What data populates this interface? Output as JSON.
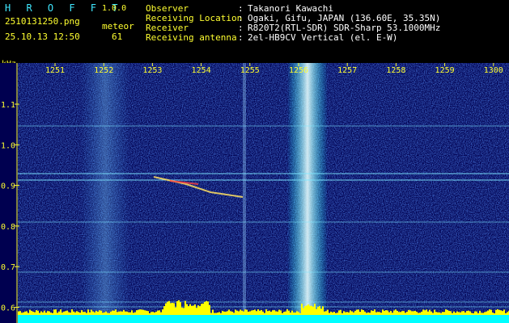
{
  "header": {
    "app_name": "H R O F F T",
    "version": "1.0.0",
    "filename": "2510131250.png",
    "datetime": "25.10.13 12:50",
    "mode_label": "meteor",
    "count": "61",
    "fields": [
      {
        "label": "Observer",
        "value": "Takanori Kawachi"
      },
      {
        "label": "Receiving Location",
        "value": "Ogaki, Gifu, JAPAN (136.60E, 35.35N)"
      },
      {
        "label": "Receiver",
        "value": "R820T2(RTL-SDR) SDR-Sharp 53.1000MHz"
      },
      {
        "label": "Receiving antenna",
        "value": "2el-HB9CV Vertical (el. E-W)"
      }
    ]
  },
  "spectrogram": {
    "y_unit": "kHz",
    "x_ticks": [
      "1251",
      "1252",
      "1253",
      "1254",
      "1255",
      "1256",
      "1257",
      "1258",
      "1259",
      "1300"
    ],
    "y_ticks": [
      "1.1",
      "1.0",
      "0.9",
      "0.8",
      "0.7",
      "0.6"
    ],
    "colors": {
      "background": "#000050",
      "noise": "#1a4cff",
      "text": "#ffff30",
      "signal": "#00ffff"
    }
  }
}
